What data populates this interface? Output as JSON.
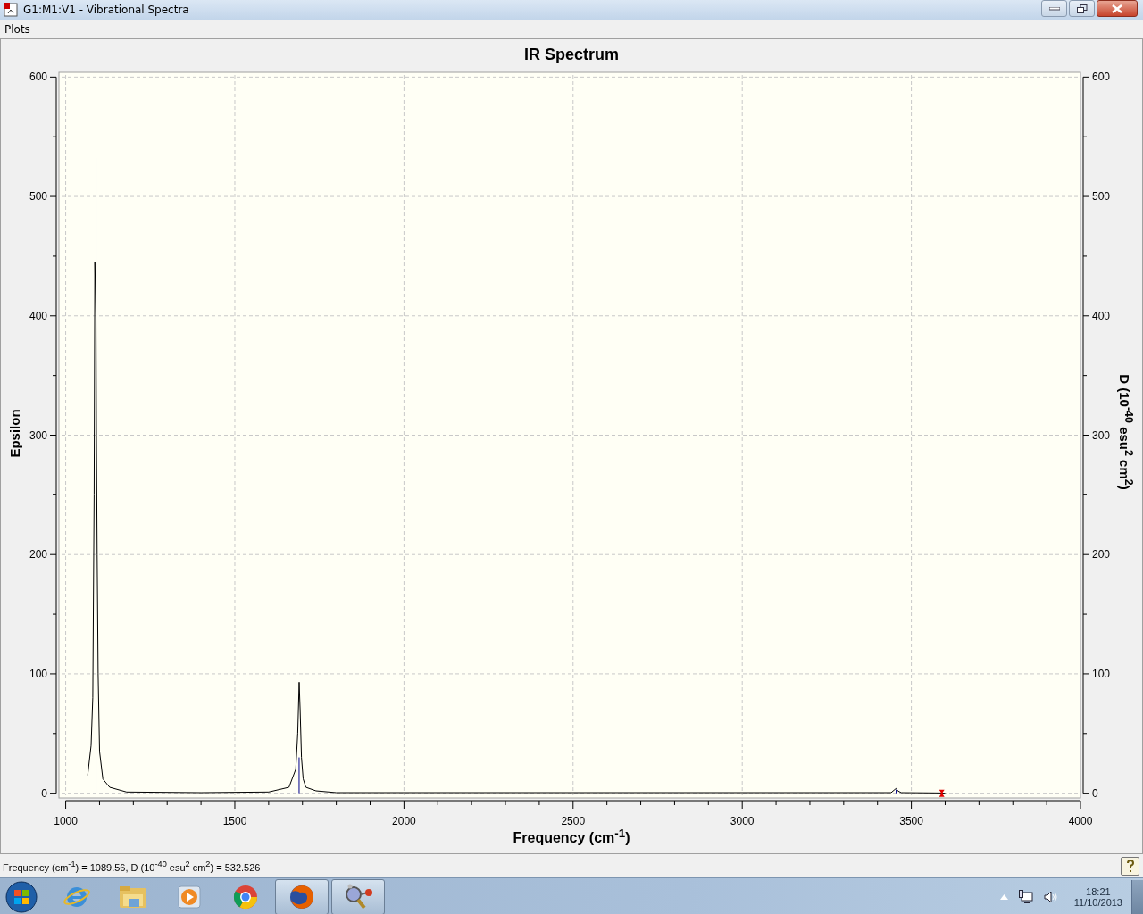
{
  "window": {
    "title": "G1:M1:V1 - Vibrational Spectra"
  },
  "menu": [
    "Plots"
  ],
  "plot": {
    "right_axis_label": "D (10$^{-40}$ esu$^{2}$ cm$^{2}$)",
    "right_yticks": [
      "600",
      "500",
      "400",
      "300",
      "200",
      "100",
      "0"
    ],
    "chart_data": {
      "type": "line",
      "title": "IR Spectrum",
      "xlabel": "Frequency (cm$^{-1}$)",
      "ylabel": "Epsilon",
      "grid": true,
      "xlim": [
        980,
        4000
      ],
      "ylim": [
        -4,
        604
      ],
      "xticks": [
        1000,
        1500,
        2000,
        2500,
        3000,
        3500,
        4000
      ],
      "yticks": [
        {
          "value": 0,
          "label": "0"
        },
        {
          "value": 100,
          "label": "100"
        },
        {
          "value": 200,
          "label": "200"
        },
        {
          "value": 300,
          "label": "300"
        },
        {
          "value": 400,
          "label": "400"
        },
        {
          "value": 500,
          "label": "500"
        },
        {
          "value": 600,
          "label": "600"
        }
      ],
      "x": [
        1065,
        1075,
        1080,
        1084,
        1086,
        1088,
        1089.56,
        1091,
        1093,
        1096,
        1100,
        1110,
        1130,
        1180,
        1400,
        1600,
        1660,
        1680,
        1686,
        1690,
        1693,
        1697,
        1702,
        1710,
        1740,
        1800,
        3440,
        3455,
        3460,
        3470,
        3590,
        3600
      ],
      "series": [
        {
          "color": "#000000",
          "values": [
            15,
            40,
            80,
            250,
            445,
            420,
            400,
            300,
            200,
            100,
            35,
            12,
            5,
            1,
            0.5,
            1,
            5,
            20,
            50,
            93,
            70,
            30,
            12,
            5,
            2,
            0.5,
            0.5,
            4,
            2,
            0.5,
            0.2,
            0
          ]
        },
        {
          "type": "bar",
          "color": "#00008b",
          "values": [
            null,
            null,
            null,
            null,
            null,
            null,
            532.5,
            null,
            null,
            null,
            null,
            null,
            null,
            null,
            null,
            null,
            null,
            null,
            null,
            30,
            null,
            null,
            null,
            null,
            null,
            null,
            null,
            3,
            null,
            null,
            null,
            null
          ]
        }
      ]
    }
  },
  "status_bar": {
    "text": "Frequency (cm$^{-1}$) = 1089.56, D (10$^{-40}$ esu$^{2}$ cm$^{2}$) = 532.526"
  },
  "taskbar": {
    "apps": [
      {
        "running": false
      },
      {
        "running": false
      },
      {
        "running": false
      },
      {
        "running": false
      },
      {
        "running": true
      },
      {
        "running": true
      }
    ],
    "time": "18:21",
    "date": "11/10/2013"
  }
}
